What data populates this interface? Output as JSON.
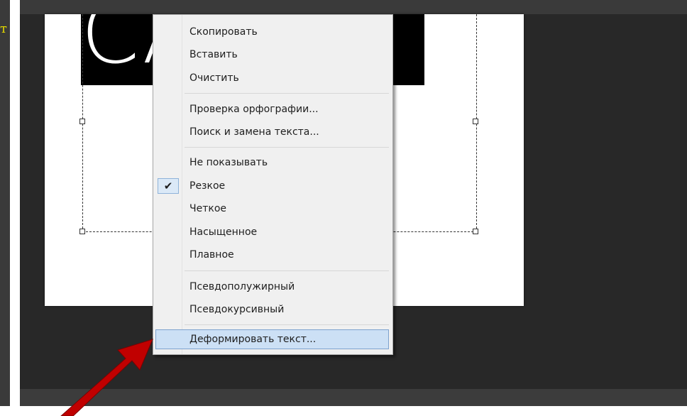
{
  "stray_char": "т",
  "banner_text": "CA          K",
  "menu": {
    "items_top": [
      {
        "label": "Скопировать"
      },
      {
        "label": "Вставить"
      },
      {
        "label": "Очистить"
      }
    ],
    "items_group2": [
      {
        "label": "Проверка орфографии..."
      },
      {
        "label": "Поиск и замена текста..."
      }
    ],
    "items_group3": [
      {
        "label": "Не показывать",
        "checked": false
      },
      {
        "label": "Резкое",
        "checked": true
      },
      {
        "label": "Четкое",
        "checked": false
      },
      {
        "label": "Насыщенное",
        "checked": false
      },
      {
        "label": "Плавное",
        "checked": false
      }
    ],
    "items_group4": [
      {
        "label": "Псевдополужирный"
      },
      {
        "label": "Псевдокурсивный"
      }
    ],
    "items_group5": [
      {
        "label": "Деформировать текст...",
        "highlighted": true
      }
    ],
    "checkmark_icon": "checkmark-icon"
  },
  "colors": {
    "arrow": "#c00000",
    "highlight": "#cce0f5",
    "menu_bg": "#f0f0f0"
  }
}
